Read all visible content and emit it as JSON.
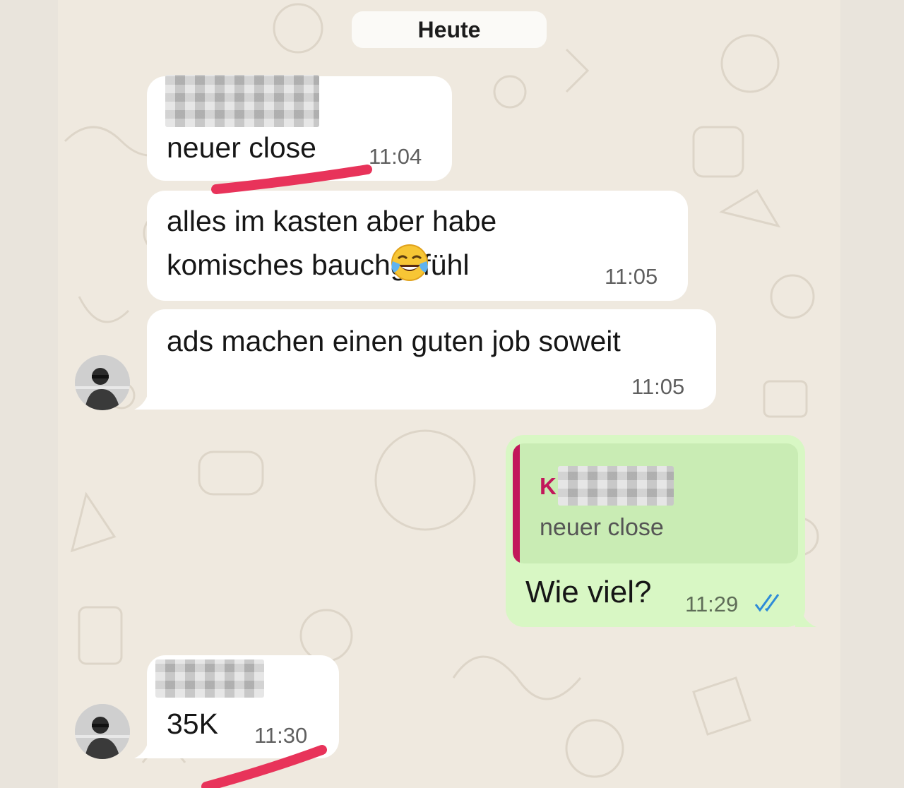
{
  "date_separator": "Heute",
  "messages": [
    {
      "text": "neuer close",
      "time": "11:04"
    },
    {
      "line1": "alles im kasten aber habe",
      "line2": "komisches bauchgefühl",
      "emoji": "face-with-tears-of-joy",
      "time": "11:05"
    },
    {
      "text": "ads machen einen guten job soweit",
      "time": "11:05"
    },
    {
      "quote_initial": "K",
      "quote_text": "neuer close",
      "text": "Wie viel?",
      "time": "11:29",
      "status": "read"
    },
    {
      "text": "35K",
      "time": "11:30"
    }
  ],
  "colors": {
    "background": "#efe9df",
    "incoming_bubble": "#ffffff",
    "outgoing_bubble": "#d8f7c4",
    "quote_accent": "#c2185b",
    "read_ticks": "#2e8bd8",
    "highlight_stroke": "#e8335a"
  }
}
